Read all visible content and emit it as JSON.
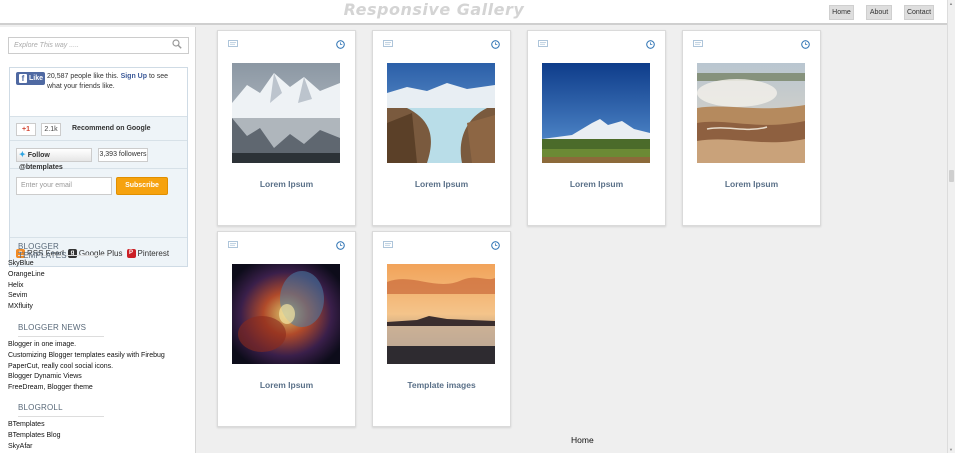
{
  "header": {
    "title": "Responsive Gallery",
    "nav": [
      {
        "label": "Home"
      },
      {
        "label": "About"
      },
      {
        "label": "Contact"
      }
    ]
  },
  "sidebar": {
    "search_placeholder": "Explore This way .....",
    "facebook": {
      "button_label": "Like",
      "text_count": "20,587 people like this.",
      "link": "Sign Up",
      "text_rest": "to see what your friends like."
    },
    "google": {
      "button_label": "+1",
      "count": "2.1k",
      "text": "Recommend on Google"
    },
    "twitter": {
      "button_label": "Follow @btemplates",
      "count": "3,393 followers"
    },
    "email": {
      "placeholder": "Enter your email",
      "subscribe_label": "Subscribe"
    },
    "links": [
      {
        "label": "RSS Feed",
        "color": "#f08a24"
      },
      {
        "label": "Google Plus",
        "color": "#333333"
      },
      {
        "label": "Pinterest",
        "color": "#cb2027"
      }
    ],
    "sections": [
      {
        "heading": "BLOGGER TEMPLATES",
        "items": [
          "SkyBlue",
          "OrangeLine",
          "Helix",
          "Sevim",
          "MXfluity"
        ]
      },
      {
        "heading": "BLOGGER NEWS",
        "items": [
          "Blogger in one image.",
          "Customizing Blogger templates easily with Firebug",
          "PaperCut, really cool social icons.",
          "Blogger Dynamic Views",
          "FreeDream, Blogger theme"
        ]
      },
      {
        "heading": "BLOGROLL",
        "items": [
          "BTemplates",
          "BTemplates Blog",
          "SkyAfar"
        ]
      }
    ]
  },
  "gallery": {
    "cards": [
      {
        "title": "Lorem Ipsum"
      },
      {
        "title": "Lorem Ipsum"
      },
      {
        "title": "Lorem Ipsum"
      },
      {
        "title": "Lorem Ipsum"
      },
      {
        "title": "Lorem Ipsum"
      },
      {
        "title": "Template images"
      }
    ]
  },
  "footer": {
    "home_label": "Home"
  },
  "colors": {
    "accent": "#f6a20e",
    "card_title": "#5a7088",
    "facebook": "#4f69a2"
  }
}
